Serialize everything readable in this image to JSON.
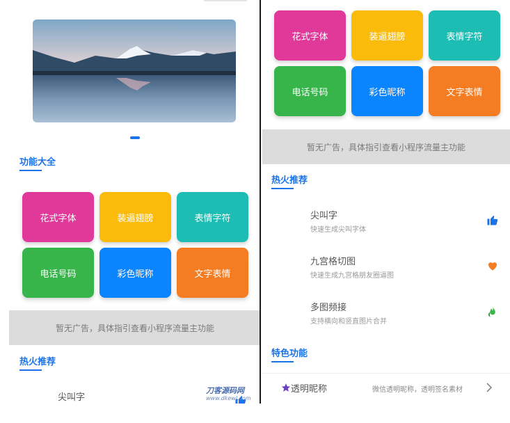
{
  "colors": {
    "accent": "#1a73e8",
    "tile_pink": "#e0399a",
    "tile_yellow": "#fbbb0b",
    "tile_teal": "#1dbdb3",
    "tile_green": "#38b54a",
    "tile_blue": "#0a84ff",
    "tile_orange": "#f47c23",
    "ad_bg": "#dcdcdc"
  },
  "left": {
    "features_title": "功能大全",
    "tiles": [
      {
        "label": "花式字体",
        "color": "#e0399a",
        "icon": "pink-tile"
      },
      {
        "label": "装逼翅膀",
        "color": "#fbbb0b",
        "icon": "yellow-tile"
      },
      {
        "label": "表情字符",
        "color": "#1dbdb3",
        "icon": "teal-tile"
      },
      {
        "label": "电话号码",
        "color": "#38b54a",
        "icon": "green-tile"
      },
      {
        "label": "彩色昵称",
        "color": "#0a84ff",
        "icon": "blue-tile"
      },
      {
        "label": "文字表情",
        "color": "#f47c23",
        "icon": "orange-tile"
      }
    ],
    "ad_text": "暂无广告，具体指引查看小程序流量主功能",
    "hot_title": "热火推荐",
    "hot_items": [
      {
        "title": "尖叫字",
        "icon": "thumbs-up-icon"
      }
    ]
  },
  "right": {
    "tiles": [
      {
        "label": "花式字体",
        "color": "#e0399a"
      },
      {
        "label": "装逼翅膀",
        "color": "#fbbb0b"
      },
      {
        "label": "表情字符",
        "color": "#1dbdb3"
      },
      {
        "label": "电话号码",
        "color": "#38b54a"
      },
      {
        "label": "彩色昵称",
        "color": "#0a84ff"
      },
      {
        "label": "文字表情",
        "color": "#f47c23"
      }
    ],
    "ad_text": "暂无广告，具体指引查看小程序流量主功能",
    "hot_title": "热火推荐",
    "hot_items": [
      {
        "title": "尖叫字",
        "subtitle": "快速生成尖叫字体",
        "icon": "thumbs-up-icon"
      },
      {
        "title": "九宫格切图",
        "subtitle": "快速生成九宫格朋友圈逼图",
        "icon": "heart-icon"
      },
      {
        "title": "多图频接",
        "subtitle": "支持横向和竖直图片合并",
        "icon": "flame-icon"
      }
    ],
    "special_title": "特色功能",
    "special_items": [
      {
        "title": "透明昵称",
        "desc": "微信透明昵称，透明签名素材",
        "icon": "star-icon"
      }
    ]
  },
  "watermark": {
    "line1": "刀客源码网",
    "line2": "www.dkewl.com"
  }
}
